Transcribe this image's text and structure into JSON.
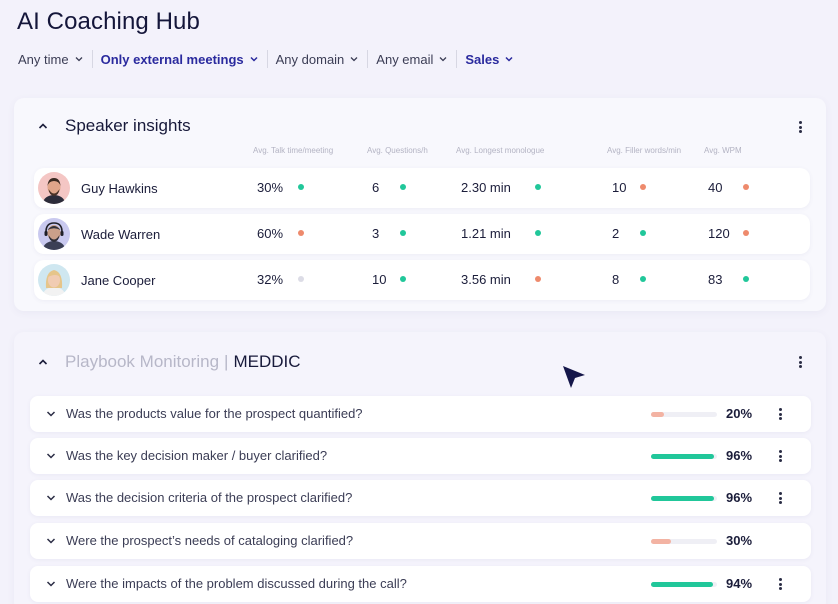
{
  "page": {
    "title": "AI Coaching Hub"
  },
  "filters": [
    {
      "label": "Any time",
      "active": false
    },
    {
      "label": "Only external meetings",
      "active": true
    },
    {
      "label": "Any domain",
      "active": false
    },
    {
      "label": "Any email",
      "active": false
    },
    {
      "label": "Sales",
      "active": true
    }
  ],
  "speaker_insights": {
    "title": "Speaker insights",
    "columns": [
      "Avg. Talk time/meeting",
      "Avg. Questions/h",
      "Avg. Longest monologue",
      "Avg. Filler words/min",
      "Avg. WPM"
    ],
    "rows": [
      {
        "name": "Guy Hawkins",
        "talk_time": "30%",
        "talk_status": "green",
        "questions": "6",
        "questions_status": "green",
        "monologue": "2.30 min",
        "monologue_status": "green",
        "filler": "10",
        "filler_status": "orange",
        "wpm": "40",
        "wpm_status": "orange"
      },
      {
        "name": "Wade Warren",
        "talk_time": "60%",
        "talk_status": "orange",
        "questions": "3",
        "questions_status": "green",
        "monologue": "1.21 min",
        "monologue_status": "green",
        "filler": "2",
        "filler_status": "green",
        "wpm": "120",
        "wpm_status": "orange"
      },
      {
        "name": "Jane Cooper",
        "talk_time": "32%",
        "talk_status": "grey",
        "questions": "10",
        "questions_status": "green",
        "monologue": "3.56 min",
        "monologue_status": "orange",
        "filler": "8",
        "filler_status": "green",
        "wpm": "83",
        "wpm_status": "green"
      }
    ]
  },
  "playbook": {
    "title_muted": "Playbook Monitoring",
    "separator": "|",
    "title_strong": "MEDDIC",
    "questions": [
      {
        "text": "Was the products value for the prospect quantified?",
        "percent_label": "20%",
        "progress": 0.2,
        "status": "orange",
        "has_menu": true
      },
      {
        "text": "Was the key decision maker / buyer clarified?",
        "percent_label": "96%",
        "progress": 0.96,
        "status": "green",
        "has_menu": true
      },
      {
        "text": "Was the decision criteria of the prospect clarified?",
        "percent_label": "96%",
        "progress": 0.96,
        "status": "green",
        "has_menu": true
      },
      {
        "text": "Were the prospect’s needs of cataloging clarified?",
        "percent_label": "30%",
        "progress": 0.3,
        "status": "orange",
        "has_menu": false
      },
      {
        "text": "Were the impacts of the problem discussed during the call?",
        "percent_label": "94%",
        "progress": 0.94,
        "status": "green",
        "has_menu": true
      }
    ]
  },
  "colors": {
    "accent": "#2a2a9e",
    "green": "#21c79a",
    "orange": "#ee8a6c",
    "orange_bar": "#f3b3a3",
    "grey": "#dcdce6"
  },
  "icons": {
    "filter_chevron": "chevron-down-icon",
    "collapse": "chevron-up-icon",
    "menu": "kebab-menu-icon",
    "row_expand": "chevron-down-icon",
    "pointer": "mouse-cursor-icon"
  }
}
